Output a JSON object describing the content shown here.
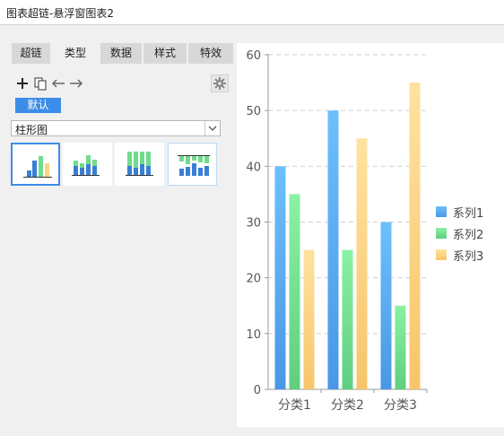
{
  "window": {
    "title": "图表超链-悬浮窗图表2"
  },
  "tabs": [
    {
      "label": "超链",
      "active": false
    },
    {
      "label": "类型",
      "active": true
    },
    {
      "label": "数据",
      "active": false
    },
    {
      "label": "样式",
      "active": false
    },
    {
      "label": "特效",
      "active": false
    }
  ],
  "toolbar": {
    "icons": [
      "add-icon",
      "copy-icon",
      "arrow-left-icon",
      "arrow-right-icon"
    ],
    "settings_icon": "gear-icon"
  },
  "default_button": {
    "label": "默认"
  },
  "chart_type_select": {
    "value": "柱形图"
  },
  "subtypes": [
    "clustered-column",
    "stacked-column",
    "percent-stacked-column",
    "rotated-stacked-column"
  ],
  "colors": {
    "accent": "#3b8de8",
    "series1": "#5aaef2",
    "series2": "#6fdc8c",
    "series3": "#fbd482"
  },
  "chart_data": {
    "type": "bar",
    "categories": [
      "分类1",
      "分类2",
      "分类3"
    ],
    "series": [
      {
        "name": "系列1",
        "values": [
          40,
          50,
          30
        ]
      },
      {
        "name": "系列2",
        "values": [
          35,
          25,
          15
        ]
      },
      {
        "name": "系列3",
        "values": [
          25,
          45,
          55
        ]
      }
    ],
    "yticks": [
      "0",
      "10",
      "20",
      "30",
      "40",
      "50",
      "60"
    ],
    "ylim": [
      0,
      60
    ],
    "grid": true,
    "legend": "right"
  }
}
